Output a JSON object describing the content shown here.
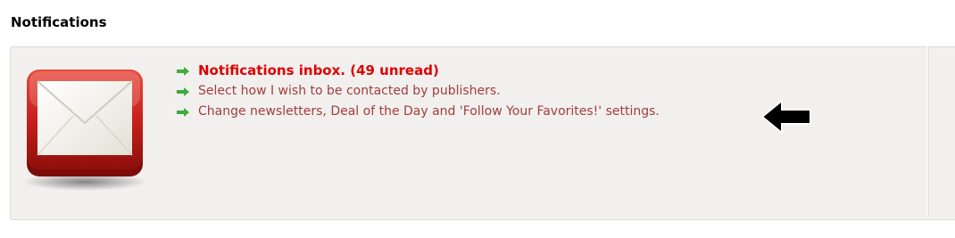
{
  "section": {
    "title": "Notifications"
  },
  "panel": {
    "icon": "envelope-icon",
    "links": [
      {
        "label": "Notifications inbox. (49 unread)",
        "emphasis": true
      },
      {
        "label": "Select how I wish to be contacted by publishers.",
        "emphasis": false
      },
      {
        "label": "Change newsletters, Deal of the Day and 'Follow Your Favorites!' settings.",
        "emphasis": false
      }
    ],
    "bullet_icon": "green-arrow-icon",
    "annotation_icon": "black-arrow-left-icon"
  },
  "colors": {
    "link": "#a23d3d",
    "link_emphasis": "#e00000",
    "bullet": "#3cab3c",
    "panel_bg": "#f1f0ee"
  }
}
